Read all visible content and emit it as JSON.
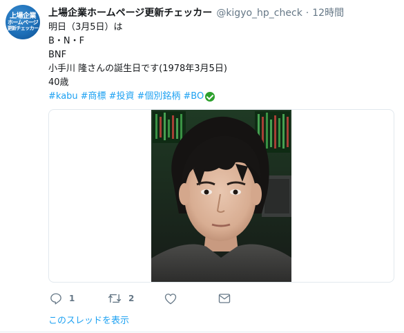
{
  "tweet": {
    "avatar": {
      "line1": "上場企業",
      "line2": "ホームページ",
      "line3": "更新チェッカー"
    },
    "display_name": "上場企業ホームページ更新チェッカー",
    "handle": "@kigyo_hp_check",
    "separator": "·",
    "time": "12時間",
    "lines": [
      "明日（3月5日）は",
      "B・N・F",
      "BNF",
      "小手川 隆さんの誕生日です(1978年3月5日)",
      "40歳"
    ],
    "hashtags": [
      "#kabu",
      "#商標",
      "#投資",
      "#個別銘柄",
      "#BO"
    ],
    "actions": {
      "reply_count": "1",
      "retweet_count": "2"
    },
    "thread_link": "このスレッドを表示"
  },
  "colors": {
    "link": "#1da1f2",
    "muted": "#657786",
    "verified": "#2ca02c",
    "avatar": "#1d6fb8"
  }
}
